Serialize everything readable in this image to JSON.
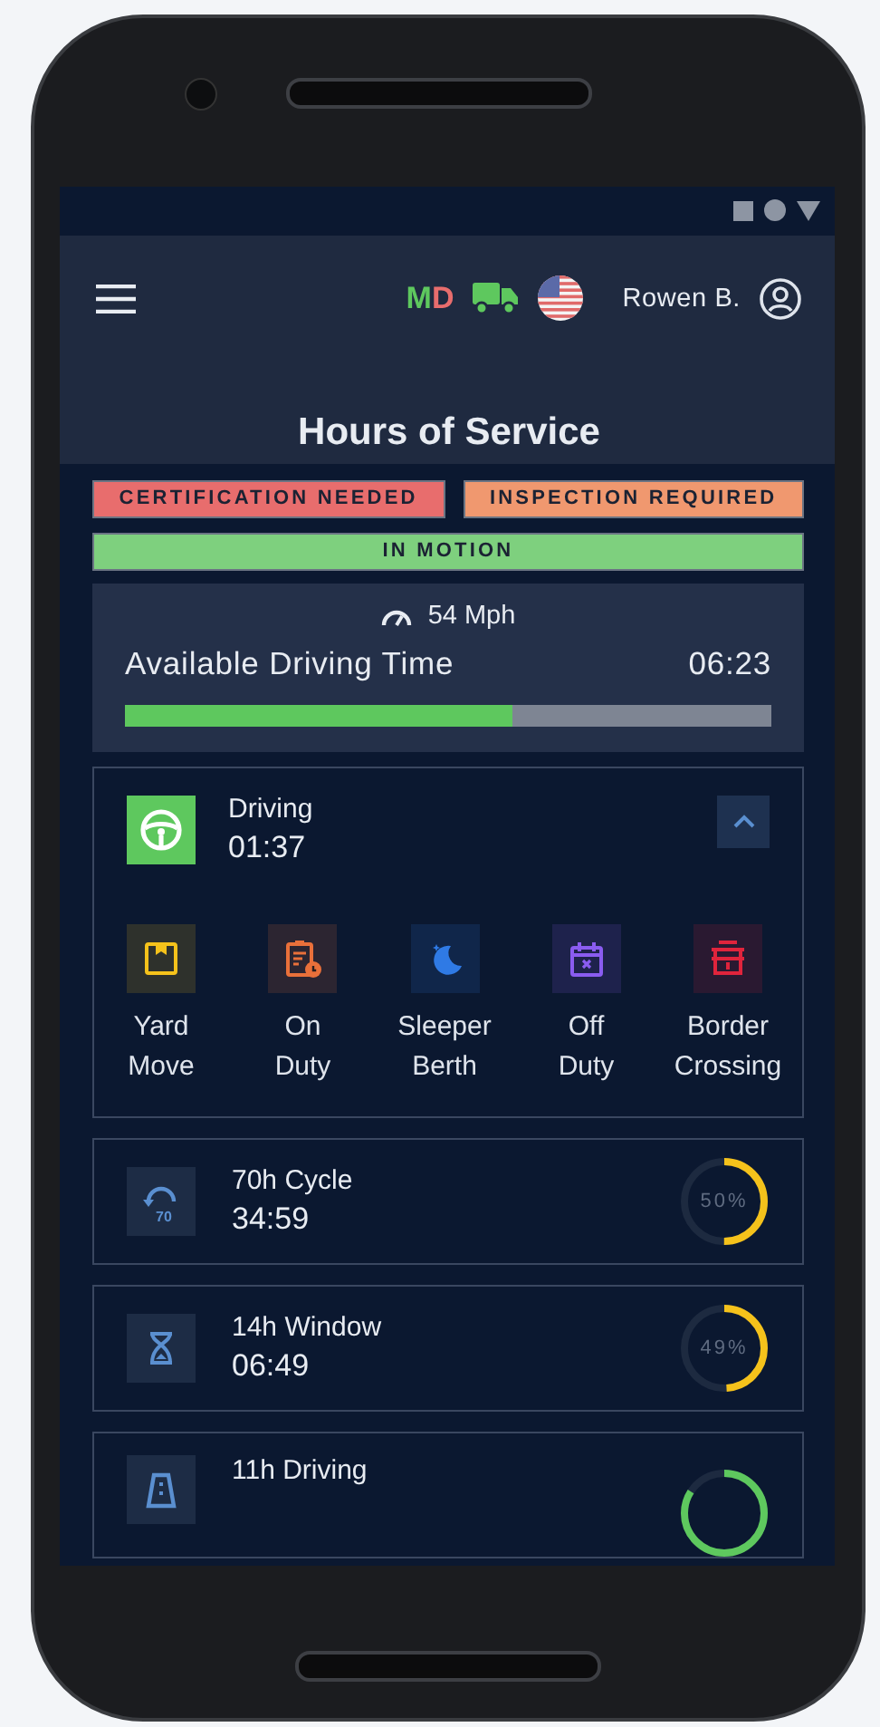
{
  "header": {
    "logo_first": "M",
    "logo_second": "D",
    "user": "Rowen B.",
    "title": "Hours of Service"
  },
  "alerts": [
    {
      "label": "CERTIFICATION NEEDED",
      "color": "#e86d6d"
    },
    {
      "label": "INSPECTION REQUIRED",
      "color": "#f0986f"
    },
    {
      "label": "IN MOTION",
      "color": "#7ed07e"
    }
  ],
  "driving_time": {
    "speed": "54 Mph",
    "label": "Available Driving Time",
    "value": "06:23",
    "level": 0.6
  },
  "current_status": {
    "label": "Driving",
    "time": "01:37",
    "expanded": true,
    "options": [
      {
        "kind": "yard",
        "label": "Yard Move",
        "color": "#f5c21b"
      },
      {
        "kind": "duty",
        "label": "On Duty",
        "color": "#e9703a"
      },
      {
        "kind": "sleeper",
        "label": "Sleeper Berth",
        "color": "#2f7ae5"
      },
      {
        "kind": "off",
        "label": "Off Duty",
        "color": "#8a5cf0"
      },
      {
        "kind": "border",
        "label": "Border Crossing",
        "color": "#e0243c"
      }
    ]
  },
  "limits": [
    {
      "kind": "cycle",
      "icon_text": "70",
      "label": "70h Cycle",
      "time": "34:59",
      "level": 0.5,
      "percent": "50%",
      "color": "#f5c21b"
    },
    {
      "kind": "window",
      "label": "14h Window",
      "time": "06:49",
      "level": 0.49,
      "percent": "49%",
      "color": "#f5c21b"
    },
    {
      "kind": "driving",
      "label": "11h Driving",
      "level": 0.84,
      "color": "#5ec85e"
    }
  ]
}
